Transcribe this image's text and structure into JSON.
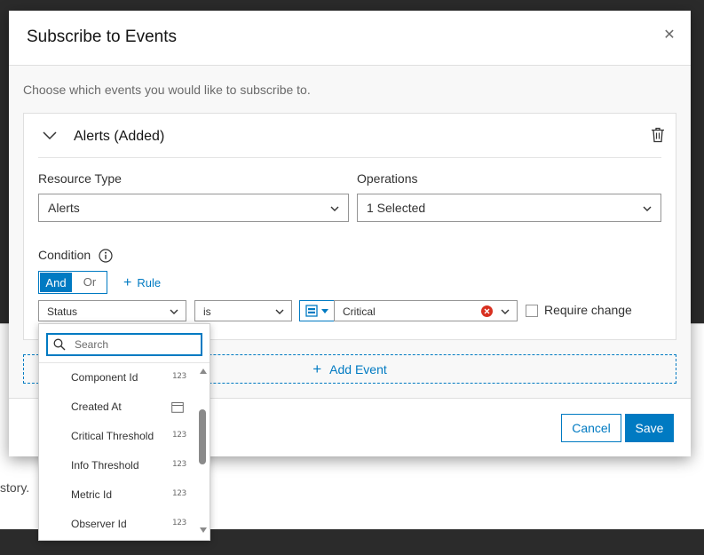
{
  "background": {
    "partial_text": "story."
  },
  "modal": {
    "title": "Subscribe to Events",
    "close_icon": "close-icon",
    "intro": "Choose which events you would like to subscribe to.",
    "event": {
      "title": "Alerts (Added)",
      "resource_type_label": "Resource Type",
      "resource_type_value": "Alerts",
      "operations_label": "Operations",
      "operations_value": "1 Selected",
      "condition_label": "Condition",
      "and_label": "And",
      "or_label": "Or",
      "add_rule_label": "Rule",
      "rule": {
        "field": "Status",
        "operator": "is",
        "value": "Critical",
        "require_change_label": "Require change",
        "require_change_checked": false
      }
    },
    "add_event_label": "Add Event",
    "cancel_label": "Cancel",
    "save_label": "Save"
  },
  "field_dropdown": {
    "search_placeholder": "Search",
    "items": [
      {
        "label": "Component Id",
        "type": "123"
      },
      {
        "label": "Created At",
        "type": "calendar"
      },
      {
        "label": "Critical Threshold",
        "type": "123"
      },
      {
        "label": "Info Threshold",
        "type": "123"
      },
      {
        "label": "Metric Id",
        "type": "123"
      },
      {
        "label": "Observer Id",
        "type": "123"
      }
    ]
  },
  "colors": {
    "accent": "#007ac2",
    "danger": "#d83020",
    "overlay": "#2b2b2b"
  }
}
